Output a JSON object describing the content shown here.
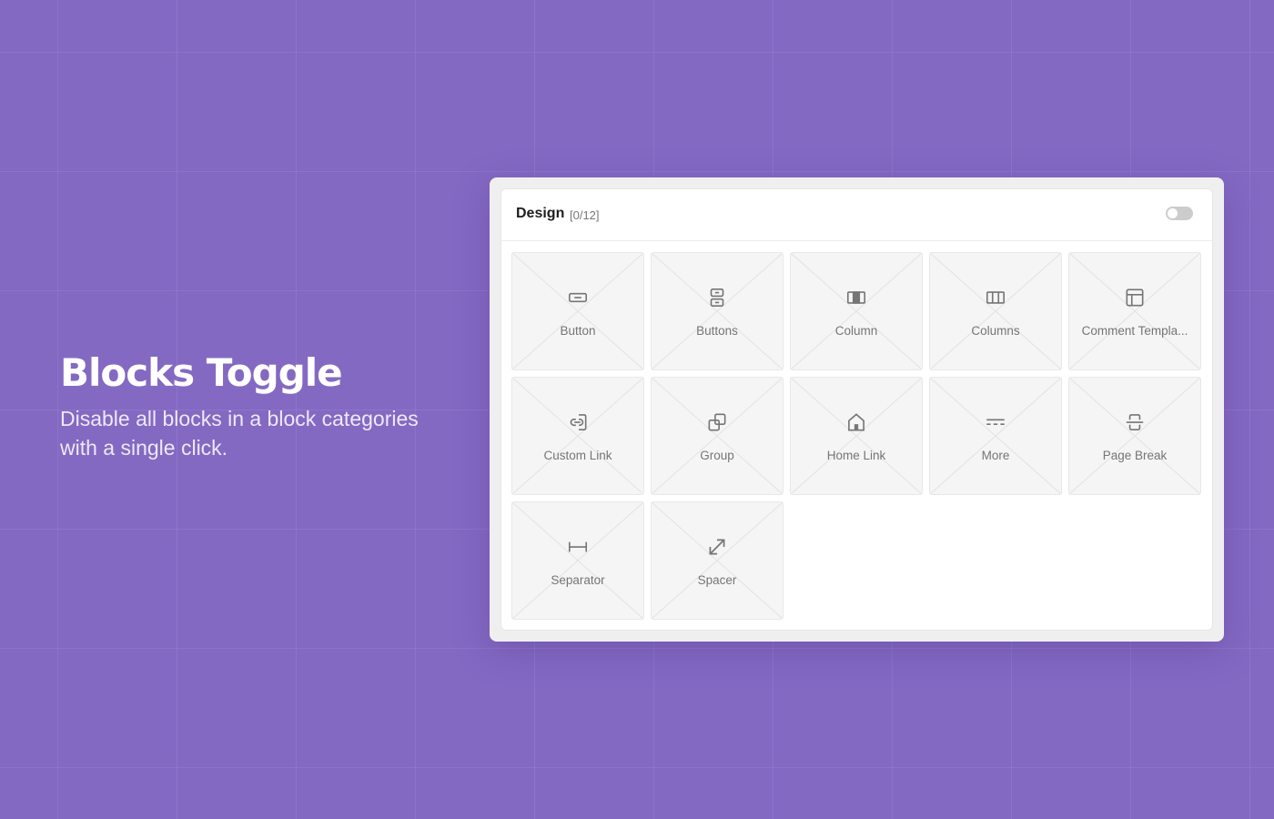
{
  "hero": {
    "title": "Blocks Toggle",
    "subtitle": "Disable all blocks in a block categories with a single click."
  },
  "panel": {
    "category_title": "Design",
    "enabled_count": "[0/12]",
    "category_toggle": {
      "enabled": false
    }
  },
  "blocks": [
    {
      "label": "Button",
      "icon": "button-icon",
      "enabled": false
    },
    {
      "label": "Buttons",
      "icon": "buttons-icon",
      "enabled": false
    },
    {
      "label": "Column",
      "icon": "column-icon",
      "enabled": false
    },
    {
      "label": "Columns",
      "icon": "columns-icon",
      "enabled": false
    },
    {
      "label": "Comment Templa...",
      "icon": "comment-template-icon",
      "enabled": false
    },
    {
      "label": "Custom Link",
      "icon": "custom-link-icon",
      "enabled": false
    },
    {
      "label": "Group",
      "icon": "group-icon",
      "enabled": false
    },
    {
      "label": "Home Link",
      "icon": "home-link-icon",
      "enabled": false
    },
    {
      "label": "More",
      "icon": "more-icon",
      "enabled": false
    },
    {
      "label": "Page Break",
      "icon": "page-break-icon",
      "enabled": false
    },
    {
      "label": "Separator",
      "icon": "separator-icon",
      "enabled": false
    },
    {
      "label": "Spacer",
      "icon": "spacer-icon",
      "enabled": false
    }
  ],
  "colors": {
    "background": "#8469c3",
    "icon": "#757575",
    "toggle_off": "#cccccc"
  }
}
